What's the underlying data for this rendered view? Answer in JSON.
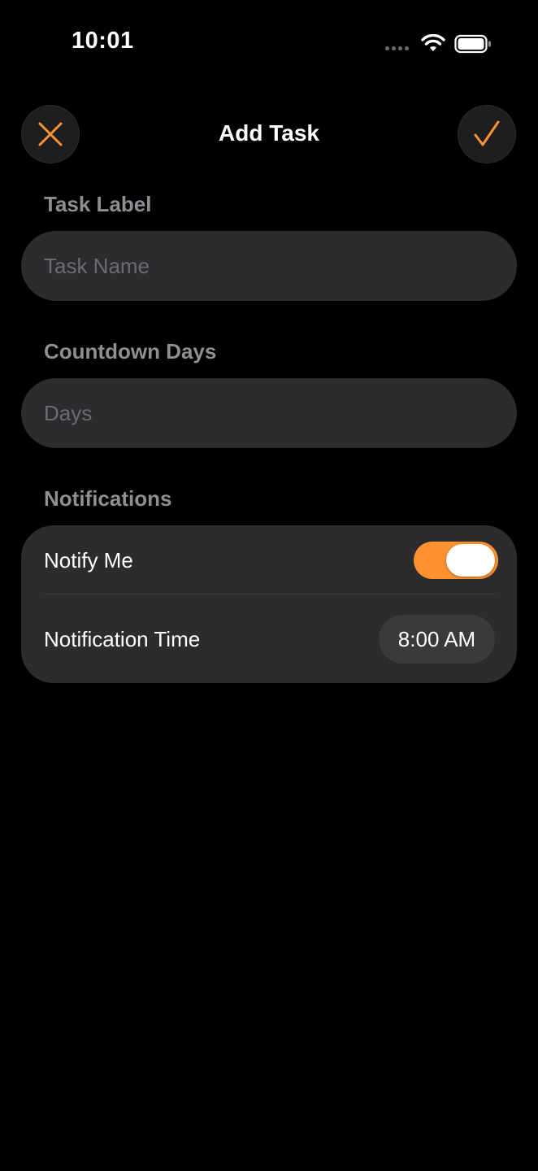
{
  "status_bar": {
    "time": "10:01"
  },
  "header": {
    "title": "Add Task",
    "close_icon": "x-mark-icon",
    "confirm_icon": "checkmark-icon"
  },
  "task_label": {
    "section": "Task Label",
    "placeholder": "Task Name",
    "value": ""
  },
  "countdown": {
    "section": "Countdown Days",
    "placeholder": "Days",
    "value": ""
  },
  "notifications": {
    "section": "Notifications",
    "notify_label": "Notify Me",
    "notify_enabled": true,
    "time_label": "Notification Time",
    "time_value": "8:00 AM"
  },
  "colors": {
    "accent": "#ff9230",
    "background": "#000000",
    "card": "#2c2c2e",
    "secondary_text": "#8e8e93"
  }
}
